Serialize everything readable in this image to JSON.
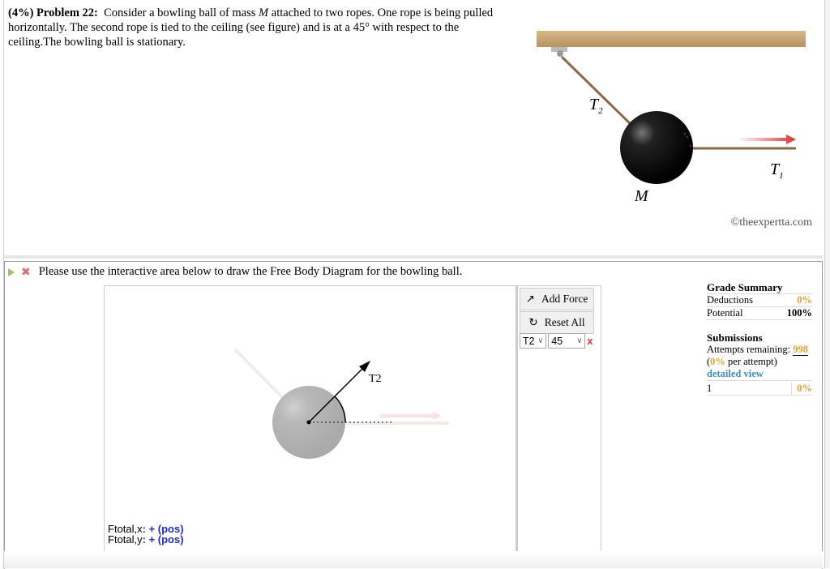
{
  "problem": {
    "weight": "(4%)",
    "label": "Problem 22:",
    "text_part1": "Consider a bowling ball of mass",
    "mass_symbol": "M",
    "text_part2": "attached to two ropes. One rope is being pulled horizontally. The second rope is tied to the ceiling (see figure) and is at a 45° with respect to the ceiling.The bowling ball is stationary."
  },
  "figure": {
    "label_t2": "T",
    "label_t2_sub": "2",
    "label_t1": "T",
    "label_t1_sub": "1",
    "label_m": "M",
    "copyright": "©theexpertta.com",
    "arrow_color": "#e03030",
    "ball_color": "#111111",
    "ceiling_color": "#c9a677"
  },
  "part": {
    "prompt": "Please use the interactive area below to draw the Free Body Diagram for the bowling ball.",
    "status": "incorrect"
  },
  "fbd": {
    "force_label": "T2",
    "force_angle_deg": 45,
    "ftotal_x_label": "F",
    "ftotal_x_sub": "total,x",
    "ftotal_x_value": ": + (pos)",
    "ftotal_y_label": "F",
    "ftotal_y_sub": "total,y",
    "ftotal_y_value": ": + (pos)"
  },
  "toolbar": {
    "add_force": "Add Force",
    "reset_all": "Reset All",
    "force_select": "T2",
    "angle_select": "45",
    "delete_label": "x"
  },
  "grade_summary": {
    "title": "Grade Summary",
    "deductions_label": "Deductions",
    "deductions_value": "0%",
    "potential_label": "Potential",
    "potential_value": "100%",
    "submissions_title": "Submissions",
    "attempts_label": "Attempts remaining:",
    "attempts_value": "998",
    "per_attempt_open": "(",
    "per_attempt_value": "0%",
    "per_attempt_text": " per attempt)",
    "detailed_view": "detailed view",
    "history": [
      {
        "num": "1",
        "value": "0%"
      }
    ]
  }
}
